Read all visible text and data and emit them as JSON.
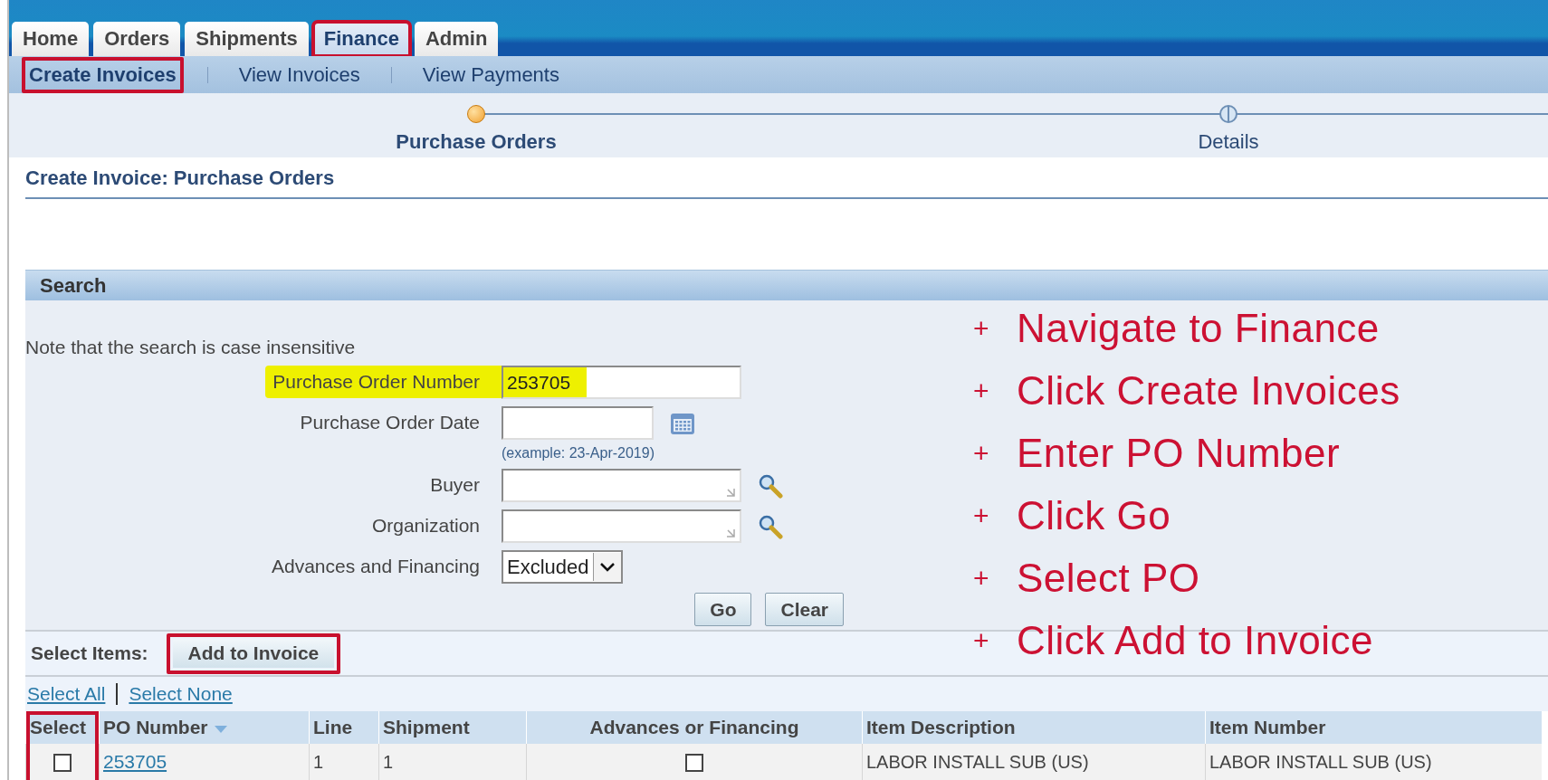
{
  "top_tabs": [
    {
      "label": "Home",
      "selected": false,
      "callout": false
    },
    {
      "label": "Orders",
      "selected": false,
      "callout": false
    },
    {
      "label": "Shipments",
      "selected": false,
      "callout": false
    },
    {
      "label": "Finance",
      "selected": true,
      "callout": true
    },
    {
      "label": "Admin",
      "selected": false,
      "callout": false
    }
  ],
  "sub_nav": [
    {
      "label": "Create Invoices",
      "selected": true,
      "callout": true
    },
    {
      "label": "View Invoices",
      "selected": false,
      "callout": false
    },
    {
      "label": "View Payments",
      "selected": false,
      "callout": false
    }
  ],
  "train": [
    {
      "label": "Purchase Orders",
      "selected": true
    },
    {
      "label": "Details",
      "selected": false
    }
  ],
  "page_title": "Create Invoice: Purchase Orders",
  "search": {
    "title": "Search",
    "note": "Note that the search is case insensitive",
    "fields": [
      {
        "kind": "text",
        "label": "Purchase Order Number",
        "value": "253705",
        "highlighted": true
      },
      {
        "kind": "date",
        "label": "Purchase Order Date",
        "hint": "(example: 23-Apr-2019)",
        "highlighted": false
      },
      {
        "kind": "lookup",
        "label": "Buyer",
        "highlighted": false
      },
      {
        "kind": "lookup",
        "label": "Organization",
        "highlighted": false
      },
      {
        "kind": "select",
        "label": "Advances and Financing",
        "value": "Excluded",
        "highlighted": false
      }
    ],
    "buttons": [
      "Go",
      "Clear"
    ]
  },
  "select_items": {
    "label": "Select Items:",
    "button": {
      "label": "Add to Invoice",
      "callout": true
    }
  },
  "select_links": [
    "Select All",
    "Select None"
  ],
  "table": {
    "columns": [
      {
        "label": "Select",
        "callout": true,
        "sorted": false
      },
      {
        "label": "PO Number",
        "callout": false,
        "sorted": true
      },
      {
        "label": "Line",
        "callout": false,
        "sorted": false
      },
      {
        "label": "Shipment",
        "callout": false,
        "sorted": false
      },
      {
        "label": "Advances or Financing",
        "callout": false,
        "sorted": false
      },
      {
        "label": "Item Description",
        "callout": false,
        "sorted": false
      },
      {
        "label": "Item Number",
        "callout": false,
        "sorted": false
      }
    ],
    "rows": [
      {
        "selected": false,
        "po_number": "253705",
        "line": "1",
        "shipment": "1",
        "advances_or_financing": false,
        "item_description": "LABOR INSTALL SUB (US)",
        "item_number": "LABOR INSTALL SUB (US)"
      }
    ]
  },
  "instructions": [
    {
      "bullet": "+",
      "text": "Navigate to Finance"
    },
    {
      "bullet": "+",
      "text": "Click Create Invoices"
    },
    {
      "bullet": "+",
      "text": "Enter PO Number"
    },
    {
      "bullet": "+",
      "text": "Click Go"
    },
    {
      "bullet": "+",
      "text": "Select PO"
    },
    {
      "bullet": "+",
      "text": "Click Add to Invoice"
    }
  ]
}
